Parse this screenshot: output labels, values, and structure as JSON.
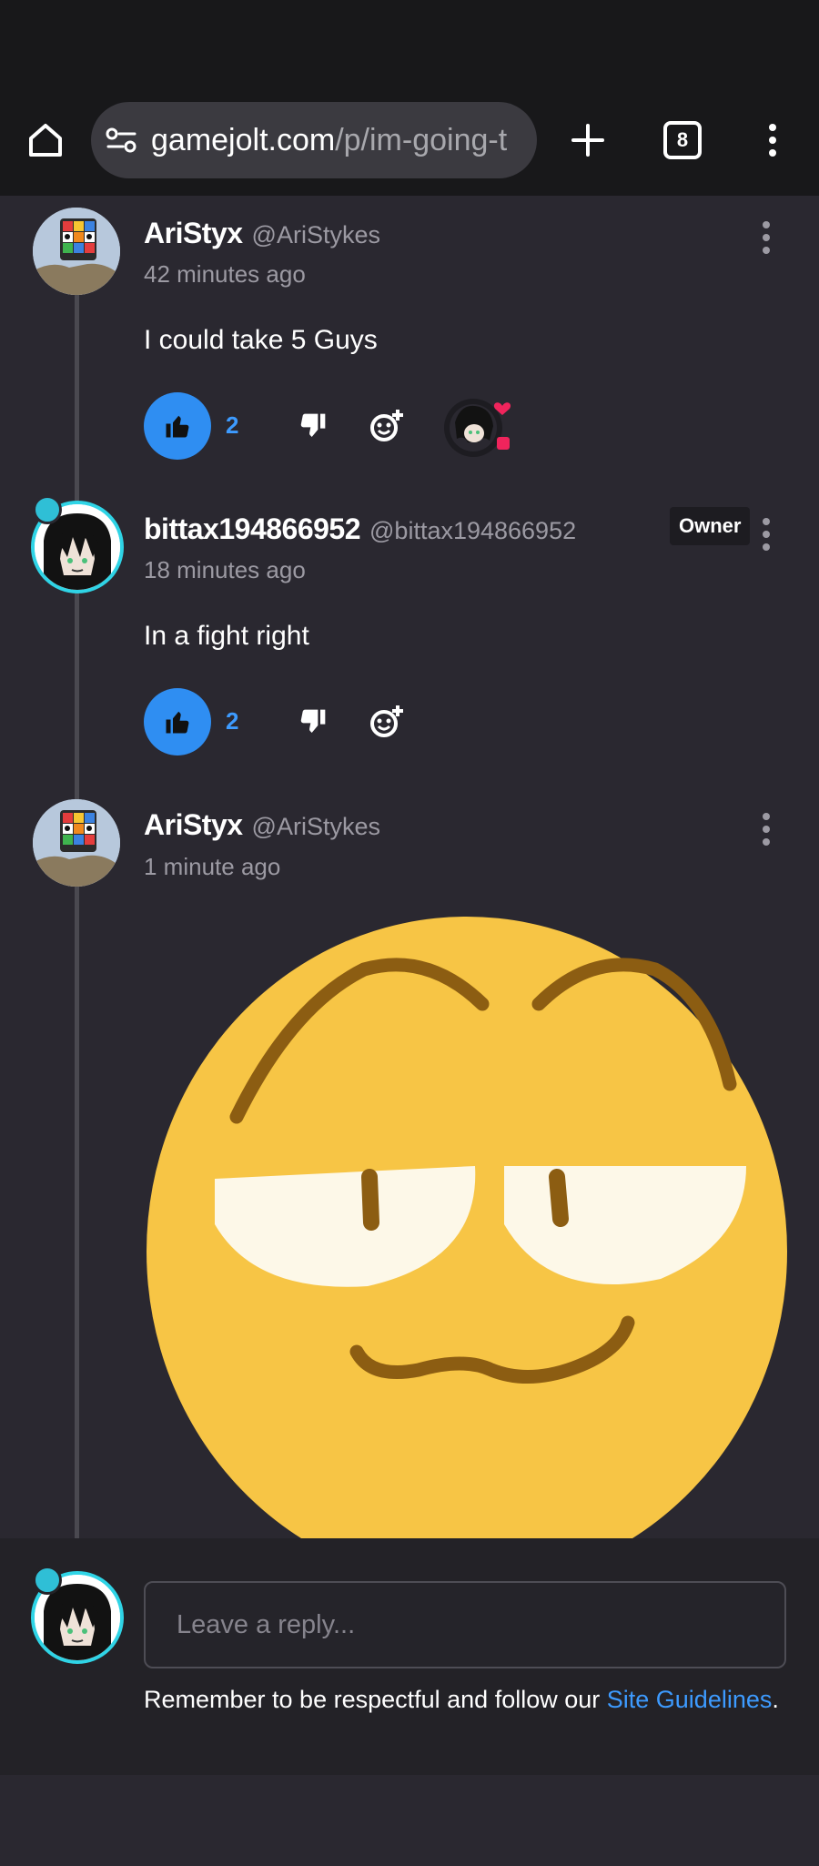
{
  "browser": {
    "url_host": "gamejolt.com",
    "url_path": "/p/im-going-t",
    "tab_count": "8",
    "icons": [
      "home-icon",
      "site-settings-icon",
      "new-tab-icon",
      "tabs-icon",
      "more-menu-icon"
    ]
  },
  "comments": [
    {
      "author": "AriStyx",
      "handle": "@AriStykes",
      "time": "42 minutes ago",
      "text": "I could take 5 Guys",
      "likes": "2"
    },
    {
      "author": "bittax194866952",
      "handle": "@bittax194866952",
      "badge": "Owner",
      "time": "18 minutes ago",
      "text": "In a fight right",
      "likes": "2"
    },
    {
      "author": "AriStyx",
      "handle": "@AriStykes",
      "time": "1 minute ago",
      "image": "smug-emoji-face"
    }
  ],
  "reply": {
    "placeholder": "Leave a reply...",
    "guidelines_prefix": "Remember to be respectful and follow our ",
    "guidelines_link": "Site Guidelines",
    "guidelines_suffix": "."
  },
  "colors": {
    "accent_blue": "#2f8ef2",
    "background": "#2a2830",
    "topbar": "#18181a",
    "heart_pink": "#f0245c"
  }
}
